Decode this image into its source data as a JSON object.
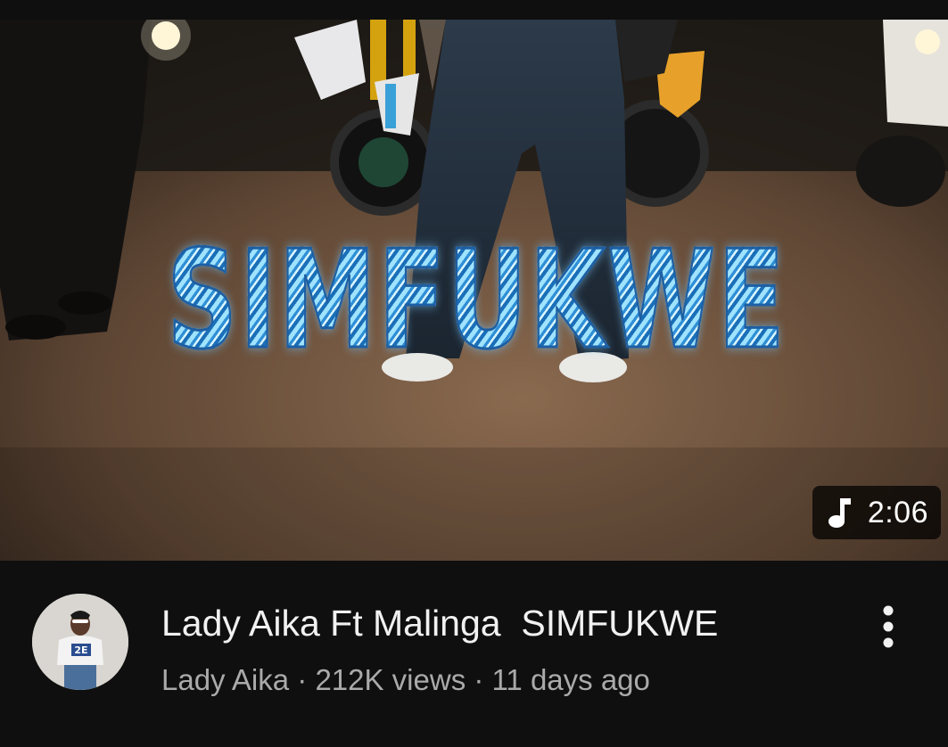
{
  "thumbnail": {
    "overlay_title": "SIMFUKWE",
    "duration": "2:06",
    "badge_icon": "music-note-icon"
  },
  "video": {
    "title": "Lady Aika Ft Malinga  SIMFUKWE",
    "channel": "Lady Aika",
    "views": "212K views",
    "age": "11 days ago",
    "separator": " · "
  },
  "menu": {
    "icon": "more-vert-icon"
  },
  "colors": {
    "background": "#0f0f0f",
    "title_text": "#f1f1f1",
    "secondary_text": "#aaaaaa",
    "overlay_text": "#7fd3ff"
  }
}
